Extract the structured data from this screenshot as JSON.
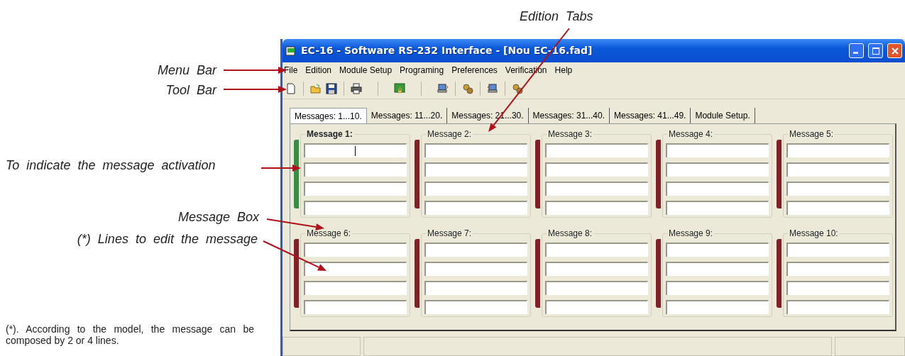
{
  "annotations": [
    {
      "kind": "edition-tabs",
      "text": "Edition  Tabs"
    },
    {
      "kind": "menu-bar",
      "text": "Menu  Bar"
    },
    {
      "kind": "tool-bar",
      "text": "Tool  Bar"
    },
    {
      "kind": "activation",
      "text": "To  indicate  the  message  activation"
    },
    {
      "kind": "message-box",
      "text": "Message  Box"
    },
    {
      "kind": "lines",
      "text": "(*)  Lines  to  edit  the  message"
    }
  ],
  "footnote": "(*). According to the model, the message can be composed by 2 or 4 lines.",
  "window": {
    "title": "EC-16 - Software RS-232 Interface - [Nou EC-16.fad]"
  },
  "menu": [
    "File",
    "Edition",
    "Module Setup",
    "Programing",
    "Preferences",
    "Verification",
    "Help"
  ],
  "toolbar": [
    {
      "kind": "new"
    },
    {
      "kind": "open"
    },
    {
      "kind": "save"
    },
    {
      "kind": "print"
    },
    {
      "kind": "hand"
    },
    {
      "kind": "send"
    },
    {
      "kind": "gears"
    },
    {
      "kind": "receive"
    },
    {
      "kind": "gears"
    }
  ],
  "tabs": [
    {
      "label": "Messages: 1...10.",
      "selected": true
    },
    {
      "label": "Messages: 11...20.",
      "selected": false
    },
    {
      "label": "Messages: 21...30.",
      "selected": false
    },
    {
      "label": "Messages: 31...40.",
      "selected": false
    },
    {
      "label": "Messages: 41...49.",
      "selected": false
    },
    {
      "label": "Module Setup.",
      "selected": false
    }
  ],
  "messages": [
    {
      "label": "Message 1:",
      "selected": true,
      "active": true
    },
    {
      "label": "Message 2:",
      "selected": false,
      "active": false
    },
    {
      "label": "Message 3:",
      "selected": false,
      "active": false
    },
    {
      "label": "Message 4:",
      "selected": false,
      "active": false
    },
    {
      "label": "Message 5:",
      "selected": false,
      "active": false
    },
    {
      "label": "Message 6:",
      "selected": false,
      "active": false
    },
    {
      "label": "Message 7:",
      "selected": false,
      "active": false
    },
    {
      "label": "Message 8:",
      "selected": false,
      "active": false
    },
    {
      "label": "Message 9:",
      "selected": false,
      "active": false
    },
    {
      "label": "Message 10:",
      "selected": false,
      "active": false
    }
  ]
}
